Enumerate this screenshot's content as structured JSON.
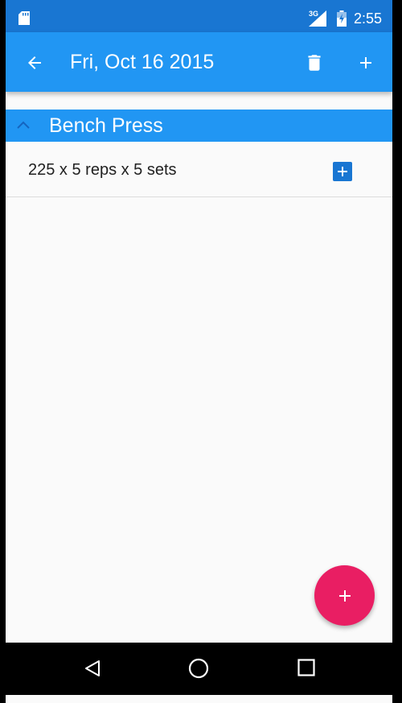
{
  "status_bar": {
    "time": "2:55",
    "network": "3G",
    "color": "#1976d2",
    "icons": [
      "sd-card-icon",
      "signal-icon",
      "battery-icon"
    ]
  },
  "app_bar": {
    "title": "Fri, Oct 16 2015",
    "color": "#2196f3",
    "icons": [
      "back-arrow-icon",
      "delete-icon",
      "add-icon"
    ]
  },
  "exercise": {
    "name": "Bench Press",
    "collapse_icon": "chevron-up-icon",
    "sets": [
      {
        "label": "225 x 5 reps x 5 sets",
        "action_icon": "add-box-icon"
      }
    ]
  },
  "fab": {
    "icon": "add-icon",
    "color": "#e91e63"
  },
  "nav_bar": {
    "icons": [
      "nav-back-icon",
      "nav-home-icon",
      "nav-recents-icon"
    ]
  }
}
